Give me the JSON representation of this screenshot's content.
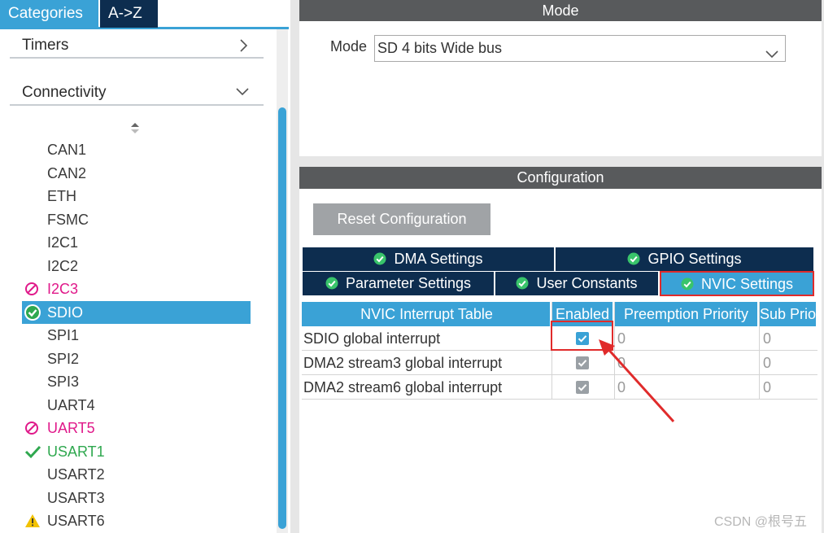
{
  "left_tabs": {
    "categories": "Categories",
    "az": "A->Z"
  },
  "groups": {
    "timers": "Timers",
    "connectivity": "Connectivity"
  },
  "peripherals": [
    {
      "name": "CAN1",
      "status": "none"
    },
    {
      "name": "CAN2",
      "status": "none"
    },
    {
      "name": "ETH",
      "status": "none"
    },
    {
      "name": "FSMC",
      "status": "none"
    },
    {
      "name": "I2C1",
      "status": "none"
    },
    {
      "name": "I2C2",
      "status": "none"
    },
    {
      "name": "I2C3",
      "status": "disabled"
    },
    {
      "name": "SDIO",
      "status": "configured-selected"
    },
    {
      "name": "SPI1",
      "status": "none"
    },
    {
      "name": "SPI2",
      "status": "none"
    },
    {
      "name": "SPI3",
      "status": "none"
    },
    {
      "name": "UART4",
      "status": "none"
    },
    {
      "name": "UART5",
      "status": "disabled"
    },
    {
      "name": "USART1",
      "status": "enabled"
    },
    {
      "name": "USART2",
      "status": "none"
    },
    {
      "name": "USART3",
      "status": "none"
    },
    {
      "name": "USART6",
      "status": "warning"
    }
  ],
  "mode_panel": {
    "title": "Mode",
    "label": "Mode",
    "selected": "SD 4 bits Wide bus"
  },
  "config_panel": {
    "title": "Configuration",
    "reset_label": "Reset Configuration",
    "tabs": {
      "dma": "DMA Settings",
      "gpio": "GPIO Settings",
      "param": "Parameter Settings",
      "user": "User Constants",
      "nvic": "NVIC Settings"
    },
    "table": {
      "headers": [
        "NVIC Interrupt Table",
        "Enabled",
        "Preemption Priority",
        "Sub Priority"
      ],
      "rows": [
        {
          "name": "SDIO global interrupt",
          "enabled": true,
          "preempt": "0",
          "sub": "0"
        },
        {
          "name": "DMA2 stream3 global interrupt",
          "enabled": true,
          "preempt": "0",
          "sub": "0"
        },
        {
          "name": "DMA2 stream6 global interrupt",
          "enabled": true,
          "preempt": "0",
          "sub": "0"
        }
      ]
    }
  },
  "watermark": "CSDN @根号五",
  "colors": {
    "accent": "#3aa2d6",
    "navy": "#0d2d4f",
    "highlight": "#e02b2b",
    "disabled": "#e0198a",
    "ok": "#2fa84f",
    "warning": "#f2c200"
  }
}
